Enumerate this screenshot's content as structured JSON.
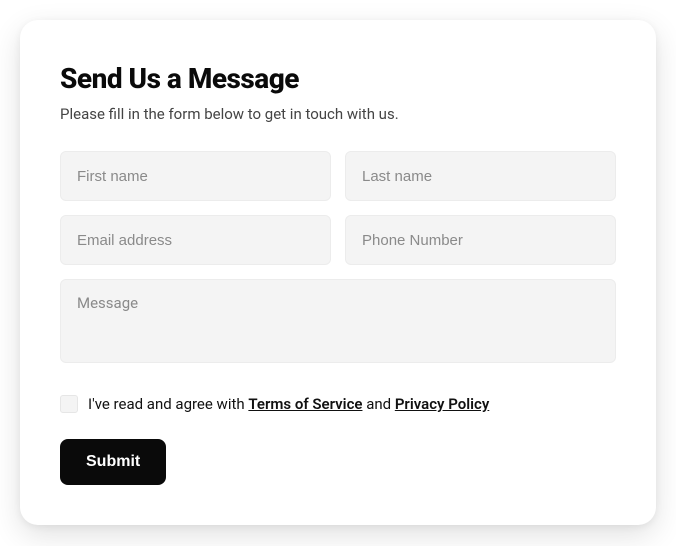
{
  "header": {
    "title": "Send Us a Message",
    "subtitle": "Please fill in the form below to get in touch with us."
  },
  "form": {
    "first_name": {
      "value": "",
      "placeholder": "First name"
    },
    "last_name": {
      "value": "",
      "placeholder": "Last name"
    },
    "email": {
      "value": "",
      "placeholder": "Email address"
    },
    "phone": {
      "value": "",
      "placeholder": "Phone Number"
    },
    "message": {
      "value": "",
      "placeholder": "Message"
    },
    "consent": {
      "checked": false,
      "prefix": "I've read and agree with ",
      "tos_label": "Terms of Service",
      "middle": " and ",
      "privacy_label": "Privacy Policy"
    },
    "submit_label": "Submit"
  }
}
